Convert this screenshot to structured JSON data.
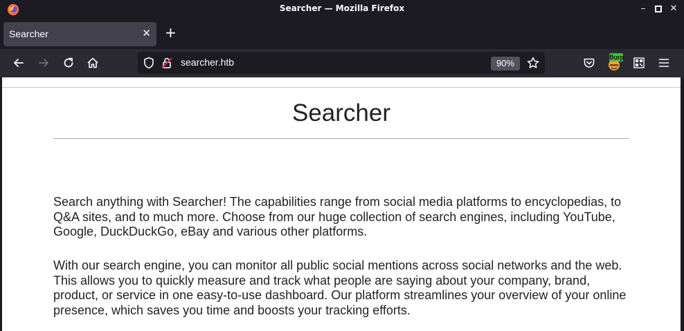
{
  "window": {
    "title": "Searcher — Mozilla Firefox",
    "controls": [
      "minimize",
      "maximize",
      "close"
    ]
  },
  "tabs": [
    {
      "label": "Searcher",
      "active": true
    }
  ],
  "navbar": {
    "url": "searcher.htb",
    "zoom": "90%",
    "extensions": {
      "burp_label": "Burp"
    }
  },
  "page": {
    "title": "Searcher",
    "paragraphs": [
      "Search anything with Searcher! The capabilities range from social media platforms to encyclopedias, to Q&A sites, and to much more. Choose from our huge collection of search engines, including YouTube, Google, DuckDuckGo, eBay and various other platforms.",
      "With our search engine, you can monitor all public social mentions across social networks and the web. This allows you to quickly measure and track what people are saying about your company, brand, product, or service in one easy-to-use dashboard. Our platform streamlines your overview of your online presence, which saves you time and boosts your tracking efforts."
    ]
  },
  "colors": {
    "chrome_bg": "#1c1b22",
    "toolbar_bg": "#2b2a33",
    "tab_active": "#42414d",
    "text_light": "#fbfbfe",
    "page_bg": "#ffffff"
  }
}
